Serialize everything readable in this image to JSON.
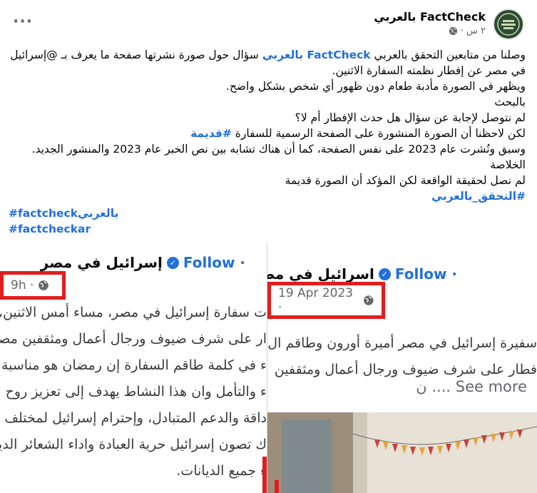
{
  "post": {
    "author": "FactCheck بالعربي",
    "time": "٢ س ·",
    "more": "···",
    "lines": [
      {
        "parts": [
          {
            "t": "وصلنا من متابعين التحقق بالعربي "
          },
          {
            "t": "FactCheck بالعربي",
            "c": "blue bold"
          },
          {
            "t": "  سؤال حول صورة نشرتها صفحة ما يعرف بـ @إسرائيل"
          }
        ]
      },
      {
        "parts": [
          {
            "t": "في مصر عن إفطار نظمته السفارة الاثنين."
          }
        ]
      },
      {
        "parts": [
          {
            "t": "ويظهر في الصورة مأدبة طعام دون ظهور أي شخص بشكل واضح."
          }
        ]
      },
      {
        "parts": [
          {
            "t": "بالبحث"
          }
        ]
      },
      {
        "parts": [
          {
            "t": " لم نتوصل لإجابة عن سؤال هل حدث الإفطار أم لا؟"
          }
        ]
      },
      {
        "parts": [
          {
            "t": "لكن لاحظنا أن الصورة المنشورة على الصفحة الرسمية للسفارة "
          },
          {
            "t": "#قديمة",
            "c": "blue bold"
          }
        ]
      },
      {
        "parts": [
          {
            "t": "وسبق ونُشرت عام 2023 على نفس الصفحة، كما أن هناك تشابه بين نص الخبر عام 2023 والمنشور الجديد."
          }
        ]
      },
      {
        "parts": [
          {
            "t": "الخلاصة"
          }
        ]
      },
      {
        "parts": [
          {
            "t": "لم نصل لحقيقة الواقعة لكن المؤكد أن الصورة قديمة"
          }
        ]
      },
      {
        "parts": [
          {
            "t": "#التحقق_بالعربي",
            "c": "blue bold"
          }
        ]
      }
    ],
    "hashtags": [
      "#factcheckبالعربي",
      "#factcheckar"
    ]
  },
  "left_card": {
    "page_name": "إسرائيل في مصر",
    "follow": "· Follow",
    "time": "9h ·",
    "lines": [
      "ت سفارة إسرائيل في مصر، مساء أمس الاثنين، حفل",
      "ار على شرف ضيوف ورجال أعمال ومثقفين مصريين",
      "ء في كلمة طاقم السفارة إن رمضان هو مناسبة خاص",
      "ء والتأمل وان هذا النشاط يهدف إلى تعزيز روح",
      "داقة والدعم المتبادل، وإحترام إسرائيل لمختلف الأدي",
      "ك تصون إسرائيل حرية العبادة واداء الشعائر الدينية",
      "ء جميع الديانات."
    ]
  },
  "right_card": {
    "page_name": "اسرائيل في مصر",
    "follow": "· Follow",
    "time": "19 Apr 2023 ·",
    "lines": [
      "سفيرة إسرائيل في مصر أميرة أورون وطاقم ال",
      "فطار على شرف ضيوف ورجال أعمال ومثقفين"
    ],
    "see_more": "See more .... ن"
  },
  "colors": {
    "accent": "#216fdb",
    "highlight": "#e11d1d"
  }
}
